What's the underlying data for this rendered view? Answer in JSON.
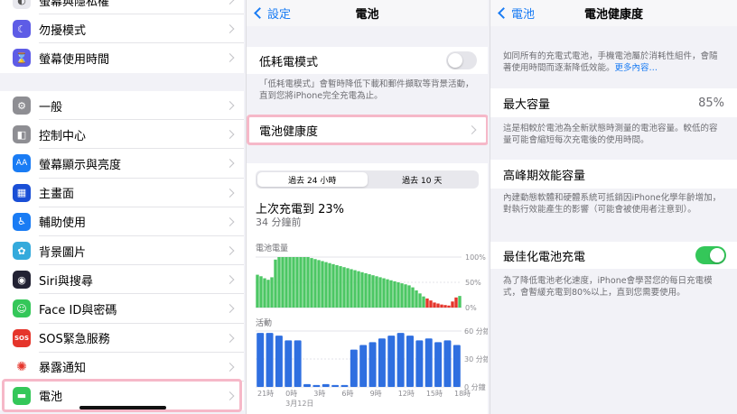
{
  "settings": {
    "items": [
      {
        "label": "螢幕與隱私權",
        "icon": "privacy-icon",
        "color": "#e8e8ee",
        "glyph": "◐"
      },
      {
        "label": "勿擾模式",
        "icon": "moon-icon",
        "color": "#5e5ce6",
        "glyph": "☾"
      },
      {
        "label": "螢幕使用時間",
        "icon": "hourglass-icon",
        "color": "#5e5ce6",
        "glyph": "⌛"
      },
      {
        "label": "一般",
        "icon": "gear-icon",
        "color": "#8e8e93",
        "glyph": "⚙"
      },
      {
        "label": "控制中心",
        "icon": "control-center-icon",
        "color": "#8e8e93",
        "glyph": "◧"
      },
      {
        "label": "螢幕顯示與亮度",
        "icon": "display-brightness-icon",
        "color": "#1a7cf4",
        "glyph": "AA"
      },
      {
        "label": "主畫面",
        "icon": "home-screen-icon",
        "color": "#1a4fd6",
        "glyph": "▦"
      },
      {
        "label": "輔助使用",
        "icon": "accessibility-icon",
        "color": "#1a7cf4",
        "glyph": "♿"
      },
      {
        "label": "背景圖片",
        "icon": "wallpaper-icon",
        "color": "#34aadc",
        "glyph": "✿"
      },
      {
        "label": "Siri與搜尋",
        "icon": "siri-icon",
        "color": "#222233",
        "glyph": "◉"
      },
      {
        "label": "Face ID與密碼",
        "icon": "face-id-icon",
        "color": "#34c759",
        "glyph": "☺"
      },
      {
        "label": "SOS緊急服務",
        "icon": "sos-icon",
        "color": "#e5352b",
        "glyph": "SOS"
      },
      {
        "label": "暴露通知",
        "icon": "exposure-icon",
        "color": "#ffffff",
        "glyph": "✺"
      },
      {
        "label": "電池",
        "icon": "battery-icon",
        "color": "#34c759",
        "glyph": "▬"
      }
    ]
  },
  "battery": {
    "back_label": "設定",
    "title": "電池",
    "low_power_label": "低耗電模式",
    "low_power_note": "「低耗電模式」會暫時降低下載和郵件擷取等背景活動，直到您將iPhone完全充電為止。",
    "health_label": "電池健康度",
    "tabs": [
      "過去 24 小時",
      "過去 10 天"
    ],
    "last_charge": "上次充電到 23%",
    "last_charge_time": "34 分鐘前",
    "level_label": "電池電量",
    "level_ticks": [
      "100%",
      "50%",
      "0%"
    ],
    "activity_label": "活動",
    "activity_ticks": [
      "60 分鐘",
      "30 分鐘",
      "0 分鐘"
    ],
    "x_ticks": [
      "21時",
      "0時",
      "3時",
      "6時",
      "9時",
      "12時",
      "15時",
      "18時"
    ],
    "x_date": "3月12日"
  },
  "health": {
    "back_label": "電池",
    "title": "電池健康度",
    "intro": "如同所有的充電式電池，手機電池屬於消耗性組件，會隨著使用時間而逐漸降低效能。",
    "more_link": "更多內容…",
    "max_capacity_label": "最大容量",
    "max_capacity_value": "85%",
    "max_capacity_note": "這是相較於電池為全新狀態時測量的電池容量。較低的容量可能會縮短每次充電後的使用時間。",
    "peak_label": "高峰期效能容量",
    "peak_note": "內建動態軟體和硬體系統可抵銷因iPhone化學年齡增加，對執行效能產生的影響（可能會被使用者注意到）。",
    "optimized_label": "最佳化電池充電",
    "optimized_note": "為了降低電池老化速度，iPhone會學習您的每日充電模式，會暫緩充電到80%以上，直到您需要使用。"
  },
  "chart_data": [
    {
      "type": "area",
      "title": "電池電量",
      "y_ticks": [
        "100%",
        "50%",
        "0%"
      ],
      "ylim": [
        0,
        100
      ],
      "x_ticks": [
        "21時",
        "0時",
        "3時",
        "6時",
        "9時",
        "12時",
        "15時",
        "18時"
      ],
      "values": [
        65,
        62,
        58,
        55,
        60,
        95,
        100,
        100,
        100,
        100,
        100,
        100,
        100,
        100,
        100,
        98,
        96,
        94,
        92,
        90,
        88,
        86,
        84,
        82,
        80,
        78,
        76,
        74,
        72,
        70,
        68,
        66,
        64,
        62,
        60,
        58,
        56,
        54,
        52,
        50,
        48,
        46,
        44,
        40,
        34,
        28,
        22,
        18,
        14,
        10,
        8,
        6,
        5,
        4,
        12,
        20,
        23
      ]
    },
    {
      "type": "bar",
      "title": "活動",
      "y_ticks": [
        "60 分鐘",
        "30 分鐘",
        "0 分鐘"
      ],
      "ylim": [
        0,
        60
      ],
      "x_ticks": [
        "21時",
        "0時",
        "3時",
        "6時",
        "9時",
        "12時",
        "15時",
        "18時"
      ],
      "values": [
        58,
        58,
        55,
        50,
        50,
        3,
        2,
        3,
        2,
        2,
        40,
        45,
        48,
        52,
        55,
        58,
        55,
        50,
        52,
        48,
        50,
        45
      ]
    }
  ]
}
